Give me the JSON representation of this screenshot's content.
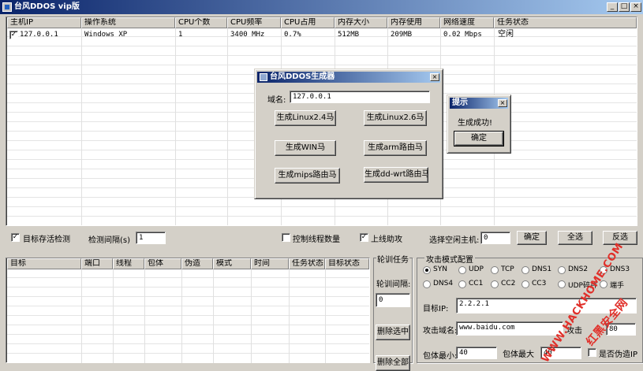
{
  "window": {
    "title": "台风DDOS vip版",
    "minimize": "_",
    "maximize": "□",
    "close": "×"
  },
  "host_table": {
    "columns": [
      "主机IP",
      "操作系统",
      "CPU个数",
      "CPU频率",
      "CPU占用",
      "内存大小",
      "内存使用",
      "网络速度",
      "任务状态"
    ],
    "rows": [
      {
        "checked": true,
        "cells": [
          "127.0.0.1",
          "Windows XP",
          "1",
          "3400 MHz",
          "0.7%",
          "512MB",
          "209MB",
          "0.02 Mbps",
          "空闲"
        ]
      }
    ]
  },
  "options_bar": {
    "target_check_label": "目标存活检测",
    "target_check_checked": true,
    "interval_label": "检测间隔(s)",
    "interval_value": "1",
    "thread_control_label": "控制线程数量",
    "thread_control_checked": false,
    "online_assist_label": "上线助攻",
    "online_assist_checked": true,
    "select_idle_label": "选择空闲主机:",
    "select_idle_value": "0",
    "confirm_label": "确定",
    "select_all_label": "全选",
    "invert_label": "反选"
  },
  "task_table": {
    "columns": [
      "目标",
      "端口",
      "线程",
      "包体",
      "伪造",
      "模式",
      "时间",
      "任务状态",
      "目标状态"
    ]
  },
  "rotation": {
    "title": "轮训任务",
    "interval_label": "轮训间隔:",
    "interval_value": "0",
    "delete_selected_label": "删除选中",
    "delete_all_label": "删除全部"
  },
  "attack": {
    "title": "攻击模式配置",
    "modes": [
      {
        "label": "SYN",
        "selected": true
      },
      {
        "label": "UDP",
        "selected": false
      },
      {
        "label": "TCP",
        "selected": false
      },
      {
        "label": "DNS1",
        "selected": false
      },
      {
        "label": "DNS2",
        "selected": false
      },
      {
        "label": "DNS3",
        "selected": false
      },
      {
        "label": "DNS4",
        "selected": false
      },
      {
        "label": "CC1",
        "selected": false
      },
      {
        "label": "CC2",
        "selected": false
      },
      {
        "label": "CC3",
        "selected": false
      },
      {
        "label": "UDP碎片",
        "selected": false
      },
      {
        "label": "端手",
        "selected": false
      }
    ],
    "target_ip_label": "目标IP:",
    "target_ip_value": "2.2.2.1",
    "domain_label": "攻击域名:",
    "domain_value": "www.baidu.com",
    "port_label": "攻击",
    "port_value": "80",
    "packet_min_label": "包体最小:",
    "packet_min_value": "40",
    "packet_max_label": "包体最大",
    "packet_max_value": "40",
    "spoof_label": "是否伪造IP",
    "spoof_checked": false
  },
  "generator": {
    "title": "台风DDOS生成器",
    "domain_label": "域名:",
    "domain_value": "127.0.0.1",
    "buttons": [
      "生成Linux2.4马",
      "生成Linux2.6马",
      "生成WIN马",
      "生成arm路由马",
      "生成mips路由马",
      "生成dd-wrt路由马"
    ]
  },
  "prompt": {
    "title": "提示",
    "message": "生成成功!",
    "ok_label": "确定"
  },
  "watermark": {
    "line1": "WWW.HACKHOME.COM",
    "line2": "红黑安全网"
  },
  "colors": {
    "titlebar": "#0a246a",
    "face": "#d4d0c8",
    "watermark": "#e0302a"
  }
}
